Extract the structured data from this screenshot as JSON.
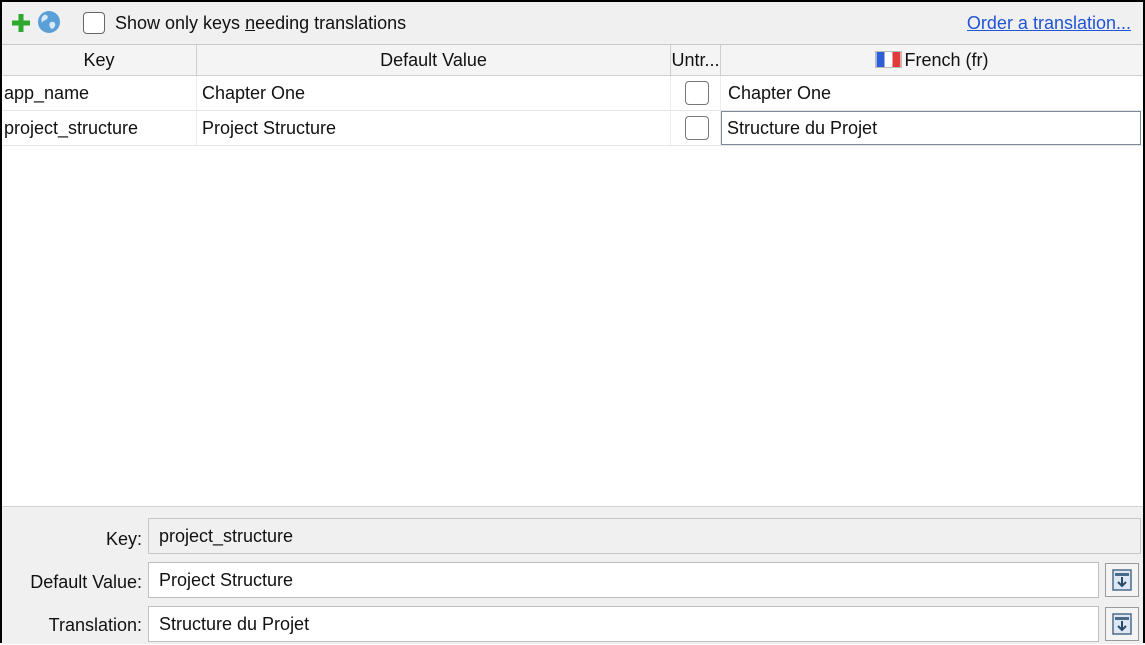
{
  "toolbar": {
    "add_icon": "plus-icon",
    "globe_icon": "globe-icon",
    "filter_label_before": "Show only keys ",
    "filter_label_mnemonic": "n",
    "filter_label_after": "eeding translations",
    "filter_checked": false,
    "order_link": "Order a translation..."
  },
  "table": {
    "columns": [
      "Key",
      "Default Value",
      "Untr...",
      "French (fr)"
    ],
    "flag_colors": [
      "#2f5fd6",
      "#ffffff",
      "#e23b3b"
    ],
    "rows": [
      {
        "key": "app_name",
        "default_value": "Chapter One",
        "untranslatable": false,
        "translation": "Chapter One"
      },
      {
        "key": "project_structure",
        "default_value": "Project Structure",
        "untranslatable": false,
        "translation": "Structure du Projet"
      }
    ]
  },
  "detail": {
    "key_label": "Key:",
    "key_value": "project_structure",
    "default_label": "Default Value:",
    "default_value": "Project Structure",
    "translation_label": "Translation:",
    "translation_value": "Structure du Projet"
  },
  "colors": {
    "accent_link": "#1f54d6",
    "add_green": "#2ea82e"
  }
}
